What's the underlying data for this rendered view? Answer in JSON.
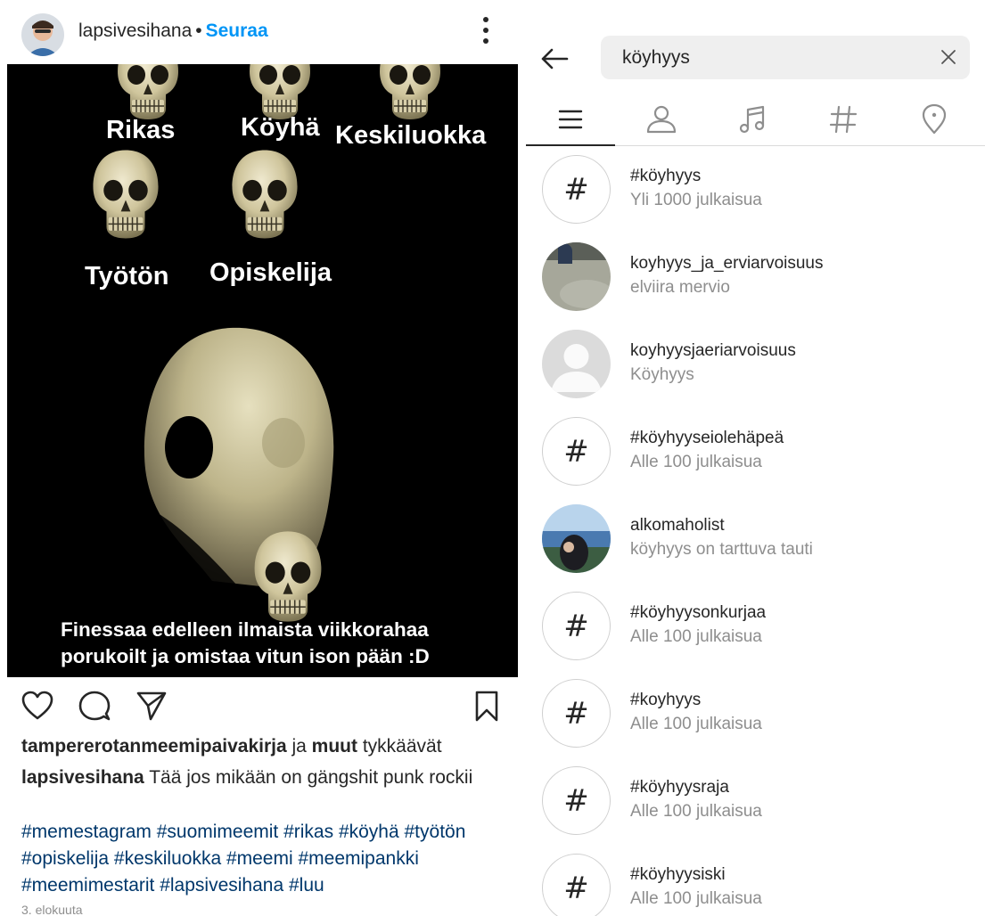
{
  "post": {
    "username": "lapsivesihana",
    "separator": "•",
    "follow_label": "Seuraa",
    "image": {
      "labels": {
        "rikas": "Rikas",
        "koyha": "Köyhä",
        "keskiluokka": "Keskiluokka",
        "tyoton": "Työtön",
        "opiskelija": "Opiskelija"
      },
      "caption": "Finessaa edelleen ilmaista viikkorahaa porukoilt ja omistaa vitun ison pään :D"
    },
    "likes": {
      "first_user": "tampererotanmeemipaivakirja",
      "connector": " ja ",
      "others": "muut",
      "suffix": " tykkäävät"
    },
    "caption": {
      "user": "lapsivesihana",
      "text": " Tää jos mikään on gängshit punk rockii"
    },
    "hashtags": "#memestagram #suomimeemit #rikas #köyhä #työtön #opiskelija #keskiluokka #meemi #meemipankki #meemimestarit #lapsivesihana #luu",
    "date": "3. elokuuta",
    "icons": [
      "heart-icon",
      "comment-icon",
      "share-icon",
      "bookmark-icon",
      "more-icon"
    ]
  },
  "search": {
    "query": "köyhyys",
    "icons": [
      "back-arrow-icon",
      "clear-icon"
    ],
    "filter_tabs": [
      "top-icon",
      "accounts-icon",
      "audio-icon",
      "tags-icon",
      "places-icon"
    ],
    "results": [
      {
        "type": "hashtag",
        "title": "#köyhyys",
        "subtitle": "Yli 1000 julkaisua"
      },
      {
        "type": "account",
        "title": "koyhyys_ja_erviarvoisuus",
        "subtitle": "elviira mervio"
      },
      {
        "type": "account-default",
        "title": "koyhyysjaeriarvoisuus",
        "subtitle": "Köyhyys"
      },
      {
        "type": "hashtag",
        "title": "#köyhyyseiolehäpeä",
        "subtitle": "Alle 100 julkaisua"
      },
      {
        "type": "account",
        "title": "alkomaholist",
        "subtitle": "köyhyys on tarttuva tauti"
      },
      {
        "type": "hashtag",
        "title": "#köyhyysonkurjaa",
        "subtitle": "Alle 100 julkaisua"
      },
      {
        "type": "hashtag",
        "title": "#koyhyys",
        "subtitle": "Alle 100 julkaisua"
      },
      {
        "type": "hashtag",
        "title": "#köyhyysraja",
        "subtitle": "Alle 100 julkaisua"
      },
      {
        "type": "hashtag",
        "title": "#köyhyysiski",
        "subtitle": "Alle 100 julkaisua"
      }
    ],
    "hash_symbol": "#",
    "colors": {
      "link": "#0095f6",
      "hashtag_text": "#00376b",
      "secondary": "#8e8e8e",
      "search_bg": "#efefef"
    }
  }
}
